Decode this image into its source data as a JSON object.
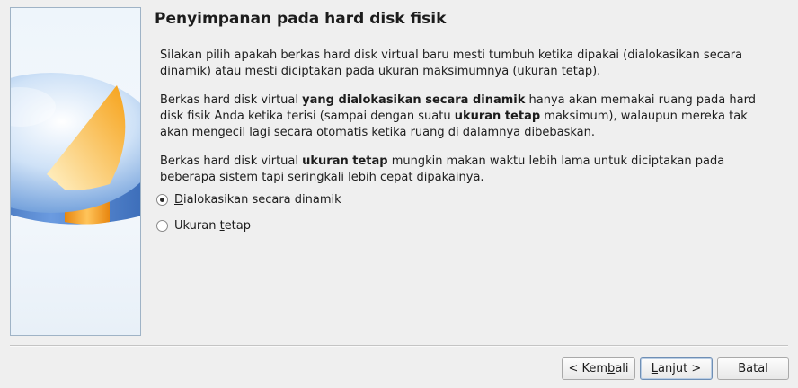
{
  "wizard": {
    "title": "Penyimpanan pada hard disk fisik",
    "paragraph1": "Silakan pilih apakah berkas hard disk virtual baru mesti tumbuh ketika dipakai (dialokasikan secara dinamik) atau mesti diciptakan pada ukuran maksimumnya (ukuran tetap).",
    "paragraph2": {
      "part1": "Berkas hard disk virtual ",
      "bold1": "yang dialokasikan secara dinamik",
      "part2": " hanya akan memakai ruang pada hard disk fisik Anda ketika terisi (sampai dengan suatu ",
      "bold2": "ukuran tetap",
      "part3": " maksimum), walaupun mereka tak akan mengecil lagi secara otomatis ketika ruang di dalamnya dibebaskan."
    },
    "paragraph3": {
      "part1": "Berkas hard disk virtual ",
      "bold1": "ukuran tetap",
      "part2": " mungkin makan waktu lebih lama untuk diciptakan pada beberapa sistem tapi seringkali lebih cepat dipakainya."
    },
    "options": [
      {
        "mnemonic": "D",
        "rest": "ialokasikan secara dinamik",
        "checked": true
      },
      {
        "before": "Ukuran ",
        "mnemonic": "t",
        "rest": "etap",
        "checked": false
      }
    ]
  },
  "buttons": {
    "back": {
      "prefix": "< Kem",
      "mnemonic": "b",
      "suffix": "ali"
    },
    "next": {
      "mnemonic": "L",
      "suffix": "anjut >"
    },
    "cancel": "Batal"
  },
  "colors": {
    "pie_blue": "#5b8fd6",
    "pie_orange": "#f5a623",
    "frame": "#9fb3c6"
  },
  "icons": {
    "side": "disk-pie-chart-icon"
  }
}
